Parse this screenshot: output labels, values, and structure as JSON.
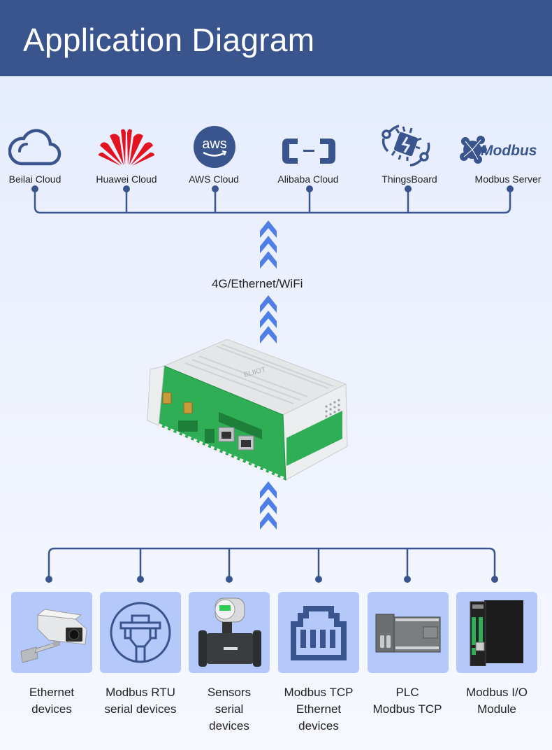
{
  "header": {
    "title": "Application Diagram"
  },
  "colors": {
    "header_bg": "#3a558e",
    "line": "#3a558e",
    "arrow": "#4f7ee6",
    "tile_bg": "#b4c8fa",
    "huawei_red": "#e3141f"
  },
  "clouds": [
    {
      "label": "Beilai Cloud",
      "icon": "cloud-outline-icon"
    },
    {
      "label": "Huawei Cloud",
      "icon": "huawei-logo-icon"
    },
    {
      "label": "AWS Cloud",
      "icon": "aws-logo-icon",
      "logo_text": "aws"
    },
    {
      "label": "Alibaba Cloud",
      "icon": "alibaba-cloud-logo-icon"
    },
    {
      "label": "ThingsBoard",
      "icon": "thingsboard-logo-icon"
    },
    {
      "label": "Modbus Server",
      "icon": "modbus-logo-icon",
      "logo_text": "Modbus"
    }
  ],
  "connection": {
    "label": "4G/Ethernet/WiFi"
  },
  "gateway": {
    "name": "IoT Gateway",
    "brand": "BLIIOT"
  },
  "devices": [
    {
      "lines": [
        "Ethernet",
        "devices"
      ],
      "icon": "ip-camera-icon"
    },
    {
      "lines": [
        "Modbus RTU",
        "serial devices"
      ],
      "icon": "serial-connector-icon"
    },
    {
      "lines": [
        "Sensors",
        "serial",
        "devices"
      ],
      "icon": "flow-meter-sensor-icon"
    },
    {
      "lines": [
        "Modbus TCP",
        "Ethernet",
        "devices"
      ],
      "icon": "ethernet-port-icon"
    },
    {
      "lines": [
        "PLC",
        "Modbus TCP"
      ],
      "icon": "plc-icon"
    },
    {
      "lines": [
        "Modbus I/O",
        "Module"
      ],
      "icon": "io-module-icon"
    }
  ]
}
